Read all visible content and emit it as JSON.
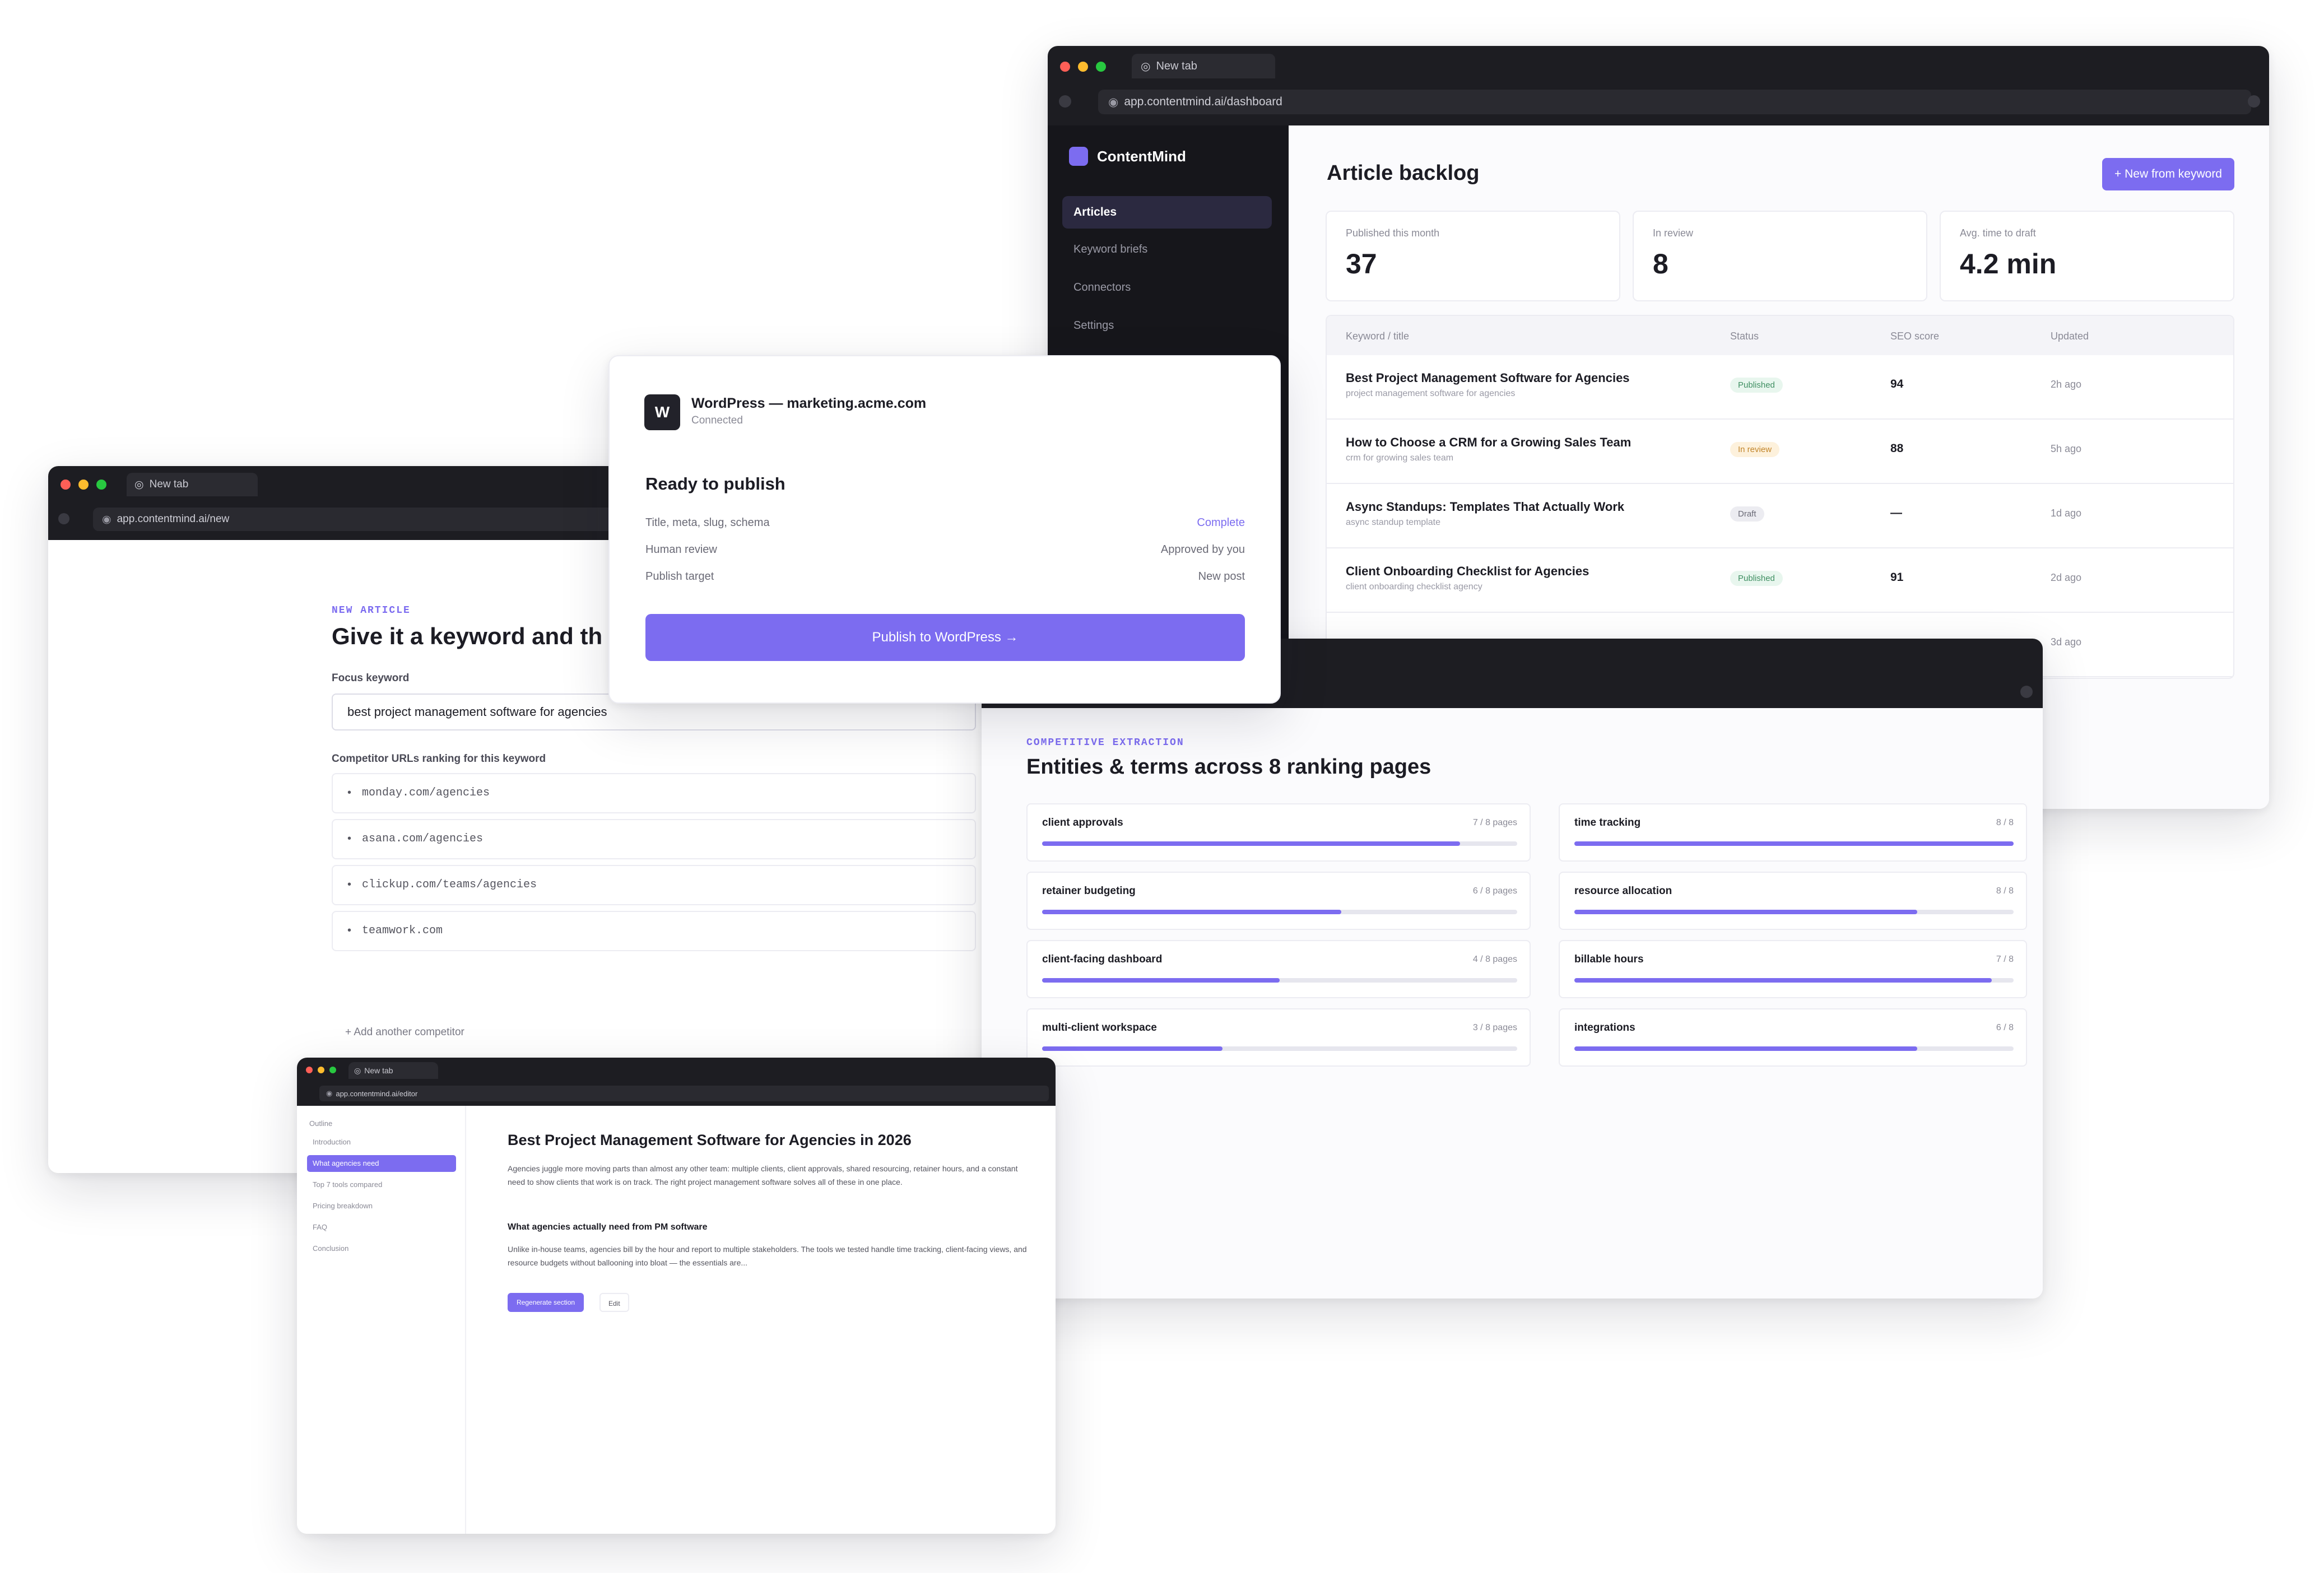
{
  "brand": {
    "accent": "#7c6cf0",
    "sidebar_bg": "#16161b",
    "chrome_bg": "#1d1d22"
  },
  "dashboard": {
    "tab_title": "New tab",
    "url": "app.contentmind.ai/dashboard",
    "app_name": "ContentMind",
    "nav": [
      "Articles",
      "Keyword briefs",
      "Connectors",
      "Settings"
    ],
    "page_title": "Article backlog",
    "new_button": "+ New from keyword",
    "stats": [
      {
        "label": "Published this month",
        "value": "37"
      },
      {
        "label": "In review",
        "value": "8"
      },
      {
        "label": "Avg. time to draft",
        "value": "4.2 min"
      }
    ],
    "table_headers": [
      "Keyword / title",
      "Status",
      "SEO score",
      "Updated"
    ],
    "rows": [
      {
        "title": "Best Project Management Software for Agencies",
        "keyword": "project management software for agencies",
        "status": "Published",
        "status_type": "published",
        "score": "94",
        "updated": "2h ago"
      },
      {
        "title": "How to Choose a CRM for a Growing Sales Team",
        "keyword": "crm for growing sales team",
        "status": "In review",
        "status_type": "review",
        "score": "88",
        "updated": "5h ago"
      },
      {
        "title": "Async Standups: Templates That Actually Work",
        "keyword": "async standup template",
        "status": "Draft",
        "status_type": "draft",
        "score": "—",
        "updated": "1d ago"
      },
      {
        "title": "Client Onboarding Checklist for Agencies",
        "keyword": "client onboarding checklist agency",
        "status": "Published",
        "status_type": "published",
        "score": "91",
        "updated": "2d ago"
      },
      {
        "title": "",
        "keyword": "",
        "status": "",
        "status_type": "",
        "score": "",
        "updated": "3d ago"
      }
    ]
  },
  "publish": {
    "logo_letter": "W",
    "site": "WordPress — marketing.acme.com",
    "connection": "Connected",
    "heading": "Ready to publish",
    "checks": [
      {
        "label": "Title, meta, slug, schema",
        "value": "Complete",
        "accent": true
      },
      {
        "label": "Human review",
        "value": "Approved by you",
        "accent": false
      },
      {
        "label": "Publish target",
        "value": "New post",
        "accent": false
      }
    ],
    "button": "Publish to WordPress →"
  },
  "new_article": {
    "tab_title": "New tab",
    "url": "app.contentmind.ai/new",
    "eyebrow": "NEW ARTICLE",
    "heading": "Give it a keyword and th",
    "focus_label": "Focus keyword",
    "focus_value": "best project management software for agencies",
    "competitor_label": "Competitor URLs ranking for this keyword",
    "competitors": [
      "monday.com/agencies",
      "asana.com/agencies",
      "clickup.com/teams/agencies",
      "teamwork.com"
    ],
    "add_competitor": "+ Add another competitor"
  },
  "entities": {
    "eyebrow": "COMPETITIVE EXTRACTION",
    "heading": "Entities & terms across 8 ranking pages",
    "left": [
      {
        "term": "client approvals",
        "count": "7 / 8 pages",
        "fill": 0.88
      },
      {
        "term": "retainer budgeting",
        "count": "6 / 8 pages",
        "fill": 0.63
      },
      {
        "term": "client-facing dashboard",
        "count": "4 / 8 pages",
        "fill": 0.5
      },
      {
        "term": "multi-client workspace",
        "count": "3 / 8 pages",
        "fill": 0.38
      }
    ],
    "right": [
      {
        "term": "time tracking",
        "count": "8 / 8",
        "fill": 1.0
      },
      {
        "term": "resource allocation",
        "count": "8 / 8",
        "fill": 0.78
      },
      {
        "term": "billable hours",
        "count": "7 / 8",
        "fill": 0.95
      },
      {
        "term": "integrations",
        "count": "6 / 8",
        "fill": 0.78
      }
    ]
  },
  "editor": {
    "tab_title": "New tab",
    "url": "app.contentmind.ai/editor",
    "outline_label": "Outline",
    "outline": [
      "Introduction",
      "What agencies need",
      "Top 7 tools compared",
      "Pricing breakdown",
      "FAQ",
      "Conclusion"
    ],
    "title": "Best Project Management Software for Agencies in 2026",
    "intro": "Agencies juggle more moving parts than almost any other team: multiple clients, client approvals, shared resourcing, retainer hours, and a constant need to show clients that work is on track. The right project management software solves all of these in one place.",
    "subheading": "What agencies actually need from PM software",
    "body": "Unlike in-house teams, agencies bill by the hour and report to multiple stakeholders. The tools we tested handle time tracking, client-facing views, and resource budgets without ballooning into bloat — the essentials are...",
    "primary_button": "Regenerate section",
    "secondary_button": "Edit"
  }
}
